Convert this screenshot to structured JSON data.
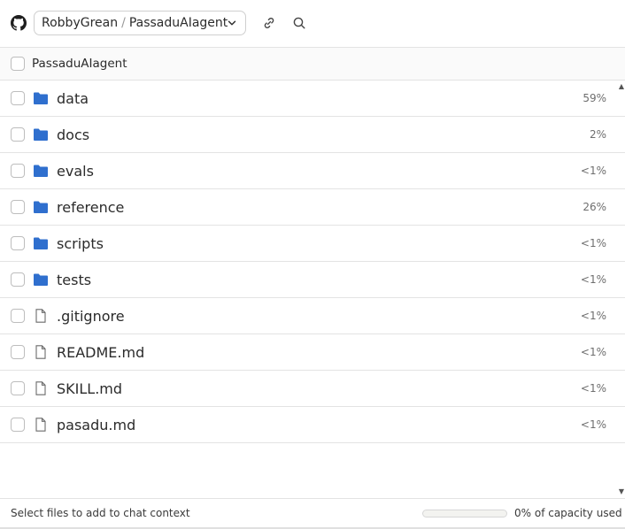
{
  "repo": {
    "owner": "RobbyGrean",
    "separator": "/",
    "name": "PassaduAIagent"
  },
  "header": {
    "label": "PassaduAIagent"
  },
  "files": [
    {
      "name": "data",
      "type": "folder",
      "percent": "59%"
    },
    {
      "name": "docs",
      "type": "folder",
      "percent": "2%"
    },
    {
      "name": "evals",
      "type": "folder",
      "percent": "<1%"
    },
    {
      "name": "reference",
      "type": "folder",
      "percent": "26%"
    },
    {
      "name": "scripts",
      "type": "folder",
      "percent": "<1%"
    },
    {
      "name": "tests",
      "type": "folder",
      "percent": "<1%"
    },
    {
      "name": ".gitignore",
      "type": "file",
      "percent": "<1%"
    },
    {
      "name": "README.md",
      "type": "file",
      "percent": "<1%"
    },
    {
      "name": "SKILL.md",
      "type": "file",
      "percent": "<1%"
    },
    {
      "name": "pasadu.md",
      "type": "file",
      "percent": "<1%"
    }
  ],
  "footer": {
    "hint": "Select files to add to chat context",
    "capacity_text": "0% of capacity used",
    "capacity_fraction": 0
  },
  "icons": {
    "brand": "github-icon",
    "link": "link-icon",
    "search": "search-icon",
    "folder": "folder-icon",
    "file": "file-icon"
  },
  "colors": {
    "folder": "#2f6fce",
    "border": "#e3e3e3",
    "text": "#2b2b2b",
    "muted": "#6e6e6e"
  }
}
